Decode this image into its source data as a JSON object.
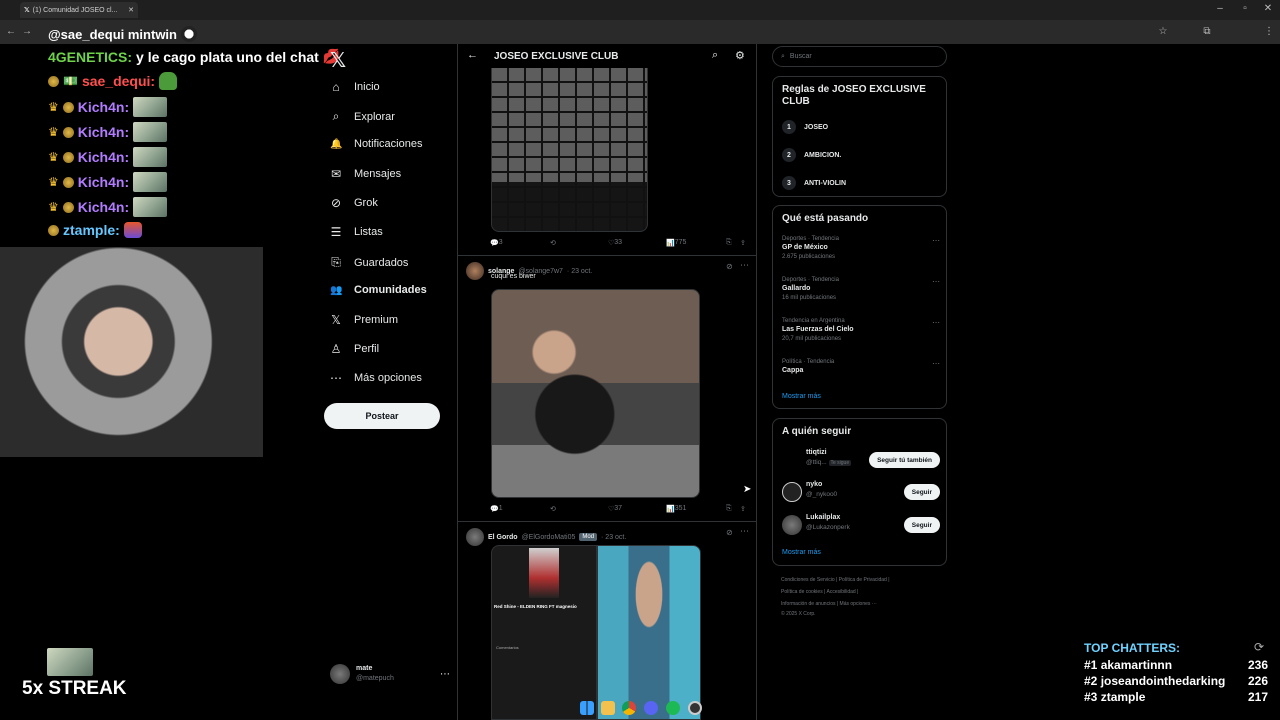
{
  "browser": {
    "tab_title": "(1) Comunidad JOSEO cl..."
  },
  "chat": {
    "header_user": "@sae_dequi mintwin",
    "lines": [
      {
        "user": "4GENETICS:",
        "text": "y le cago plata uno del chat",
        "color": "#6fd24a"
      },
      {
        "user": "sae_dequi:",
        "text": "",
        "color": "#ff4f4f"
      },
      {
        "user": "Kich4n:",
        "text": "",
        "color": "#b27cff"
      },
      {
        "user": "Kich4n:",
        "text": "",
        "color": "#b27cff"
      },
      {
        "user": "Kich4n:",
        "text": "",
        "color": "#b27cff"
      },
      {
        "user": "Kich4n:",
        "text": "",
        "color": "#b27cff"
      },
      {
        "user": "Kich4n:",
        "text": "",
        "color": "#b27cff"
      },
      {
        "user": "ztample:",
        "text": "",
        "color": "#66c7ff"
      }
    ]
  },
  "sidebar": {
    "items": [
      {
        "label": "Inicio",
        "icon": "home-icon",
        "glyph": "⌂"
      },
      {
        "label": "Explorar",
        "icon": "search-icon",
        "glyph": "⌕"
      },
      {
        "label": "Notificaciones",
        "icon": "bell-icon",
        "glyph": "🔔"
      },
      {
        "label": "Mensajes",
        "icon": "mail-icon",
        "glyph": "✉"
      },
      {
        "label": "Grok",
        "icon": "grok-icon",
        "glyph": "⊘"
      },
      {
        "label": "Listas",
        "icon": "list-icon",
        "glyph": "☰"
      },
      {
        "label": "Guardados",
        "icon": "bookmark-icon",
        "glyph": "⎘"
      },
      {
        "label": "Comunidades",
        "icon": "communities-icon",
        "glyph": "👥"
      },
      {
        "label": "Premium",
        "icon": "x-premium-icon",
        "glyph": "𝕏"
      },
      {
        "label": "Perfil",
        "icon": "profile-icon",
        "glyph": "♙"
      },
      {
        "label": "Más opciones",
        "icon": "more-icon",
        "glyph": "⋯"
      }
    ],
    "post_label": "Postear",
    "account": {
      "name": "mate",
      "handle": "@matepuch"
    }
  },
  "main": {
    "title": "JOSEO EXCLUSIVE CLUB",
    "posts": [
      {
        "replies": "3",
        "likes": "33",
        "views": "775"
      },
      {
        "author": "solange",
        "handle": "@solange7w7",
        "date": "· 23 oct.",
        "text": "cuqui es biwer",
        "replies": "1",
        "likes": "37",
        "views": "351"
      },
      {
        "author": "El Gordo",
        "handle": "@ElGordoMati05",
        "badge": "Mod",
        "date": "· 23 oct.",
        "embedded_title": "Red Shine - ELDEN RING FT magnesio",
        "embedded_comments": "Comentarios"
      }
    ]
  },
  "right": {
    "search_placeholder": "Buscar",
    "rules_title": "Reglas de JOSEO EXCLUSIVE CLUB",
    "rules": [
      {
        "num": "1",
        "text": "JOSEO"
      },
      {
        "num": "2",
        "text": "AMBICION."
      },
      {
        "num": "3",
        "text": "ANTI-VIOLIN"
      }
    ],
    "trends_title": "Qué está pasando",
    "trends": [
      {
        "category": "Deportes · Tendencia",
        "name": "GP de México",
        "count": "2.675 publicaciones"
      },
      {
        "category": "Deportes · Tendencia",
        "name": "Gallardo",
        "count": "16 mil publicaciones"
      },
      {
        "category": "Tendencia en Argentina",
        "name": "Las Fuerzas del Cielo",
        "count": "20,7 mil publicaciones"
      },
      {
        "category": "Política · Tendencia",
        "name": "Cappa",
        "count": ""
      }
    ],
    "show_more": "Mostrar más",
    "follow_title": "A quién seguir",
    "follows": [
      {
        "name": "ttiqtizi",
        "handle": "@ttiq...",
        "tag": "Te sigue",
        "button": "Seguir tú también"
      },
      {
        "name": "nyko",
        "handle": "@_nykoo0",
        "tag": "",
        "button": "Seguir"
      },
      {
        "name": "Lukailplax",
        "handle": "@Lukazonperk",
        "tag": "",
        "button": "Seguir"
      }
    ],
    "follow_more": "Mostrar más",
    "footer": [
      "Condiciones de Servicio  |  Política de Privacidad  |",
      "Política de cookies  |  Accesibilidad  |",
      "Información de anuncios  |  Más opciones ···",
      "© 2025 X Corp."
    ]
  },
  "overlay": {
    "top_chatters_title": "TOP CHATTERS:",
    "top_chatters": [
      {
        "rank": "#1",
        "name": "akamartinnn",
        "count": "236"
      },
      {
        "rank": "#2",
        "name": "joseandointhedarking",
        "count": "226"
      },
      {
        "rank": "#3",
        "name": "ztample",
        "count": "217"
      }
    ],
    "streak": "5x STREAK"
  }
}
